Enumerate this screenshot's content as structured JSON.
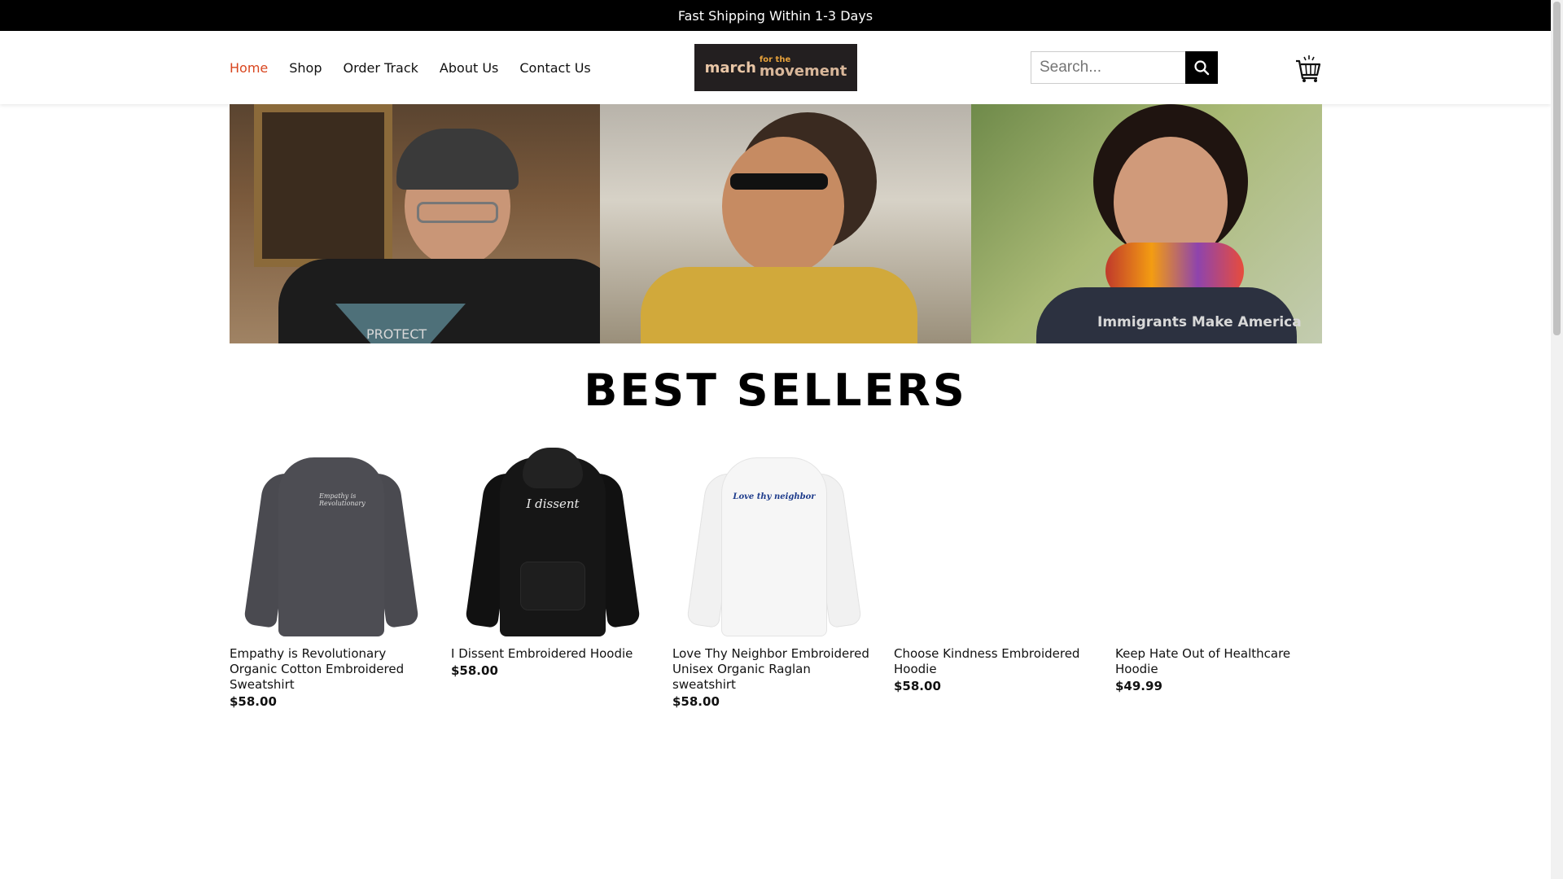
{
  "topbar": {
    "text": "Fast Shipping Within 1-3 Days"
  },
  "nav": {
    "items": [
      {
        "label": "Home",
        "active": true
      },
      {
        "label": "Shop"
      },
      {
        "label": "Order Track"
      },
      {
        "label": "About Us"
      },
      {
        "label": "Contact Us"
      }
    ]
  },
  "logo": {
    "word1": "march",
    "word2": "for the",
    "word3": "movement"
  },
  "search": {
    "placeholder": "Search..."
  },
  "hero": {
    "shirt1_text": "PROTECT",
    "shirt3_text": "Immigrants Make America"
  },
  "best_sellers": {
    "title": "BEST SELLERS",
    "products": [
      {
        "name": "Empathy is Revolutionary Organic Cotton Embroidered Sweatshirt",
        "price": "$58.00",
        "print": "Empathy is Revolutionary"
      },
      {
        "name": "I Dissent Embroidered Hoodie",
        "price": "$58.00",
        "print": "I dissent"
      },
      {
        "name": "Love Thy Neighbor Embroidered Unisex Organic Raglan sweatshirt",
        "price": "$58.00",
        "print": "Love thy neighbor"
      },
      {
        "name": "Choose Kindness Embroidered Hoodie",
        "price": "$58.00"
      },
      {
        "name": "Keep Hate Out of Healthcare Hoodie",
        "price": "$49.99"
      }
    ]
  },
  "colors": {
    "accent": "#d9461f",
    "topbar_bg": "#000000"
  }
}
